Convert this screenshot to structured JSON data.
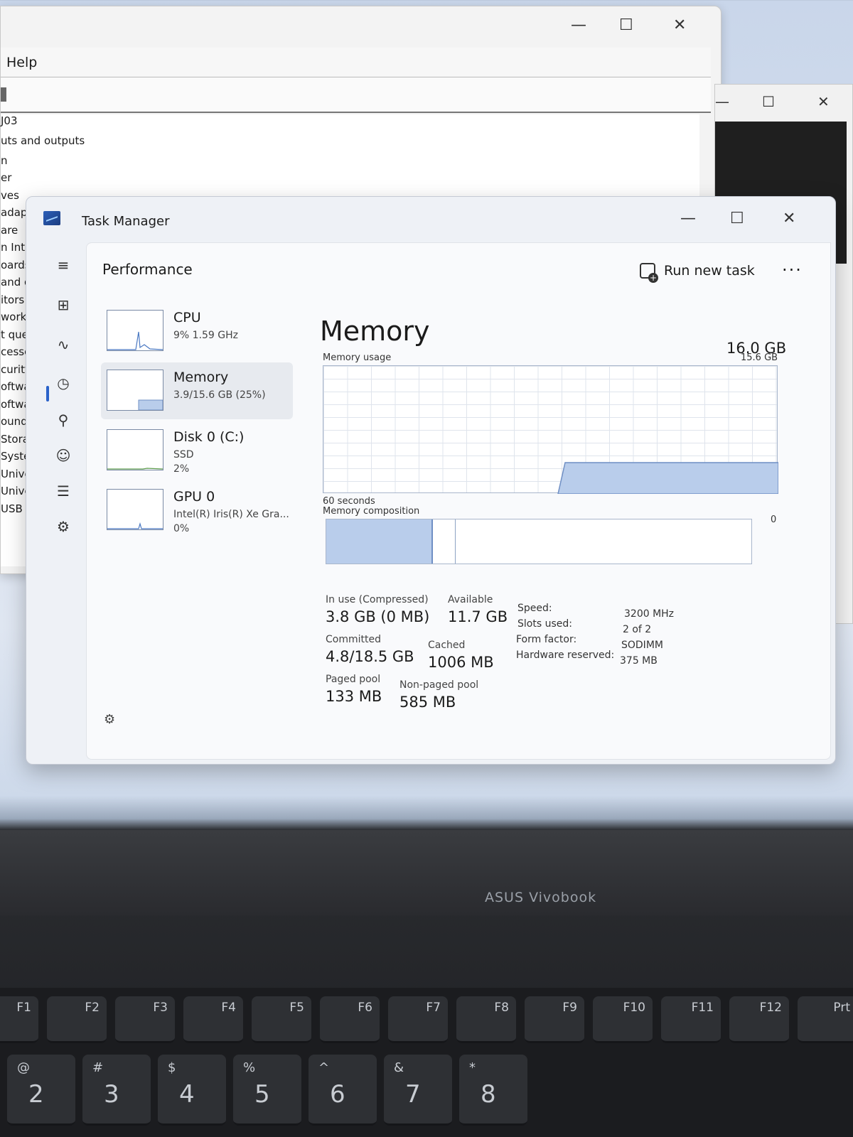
{
  "device_manager": {
    "menu_help": "Help",
    "tree_items": [
      "J03",
      "uts and outputs",
      "n",
      "er",
      "ves",
      "adap",
      "are",
      "n Interf",
      "oards",
      "and oth",
      "itors",
      "work adap",
      "t queues",
      "cessors",
      "curity devic",
      "oftware com",
      "oftware devi",
      "ound, video",
      "Storage contr",
      "System devic",
      "Universal Seri",
      "Universal Seri",
      "USB Connect"
    ]
  },
  "window_controls": {
    "minimize": "—",
    "maximize": "☐",
    "close": "✕"
  },
  "task_manager": {
    "title": "Task Manager",
    "page_title": "Performance",
    "run_new_task": "Run new task",
    "more": "···",
    "devices": [
      {
        "name": "CPU",
        "sub": "9%  1.59 GHz",
        "sub2": ""
      },
      {
        "name": "Memory",
        "sub": "3.9/15.6 GB (25%)",
        "sub2": ""
      },
      {
        "name": "Disk 0 (C:)",
        "sub": "SSD",
        "sub2": "2%"
      },
      {
        "name": "GPU 0",
        "sub": "Intel(R) Iris(R) Xe Gra...",
        "sub2": "0%"
      }
    ],
    "memory": {
      "heading": "Memory",
      "total": "16.0 GB",
      "usage_label": "Memory usage",
      "usage_max": "15.6 GB",
      "time_label": "60 seconds",
      "zero_label": "0",
      "composition_label": "Memory composition",
      "in_use_fraction": 0.25,
      "modified_fraction": 0.055,
      "stats": {
        "in_use_label": "In use (Compressed)",
        "in_use_value": "3.8 GB (0 MB)",
        "available_label": "Available",
        "available_value": "11.7 GB",
        "committed_label": "Committed",
        "committed_value": "4.8/18.5 GB",
        "cached_label": "Cached",
        "cached_value": "1006 MB",
        "paged_label": "Paged pool",
        "paged_value": "133 MB",
        "nonpaged_label": "Non-paged pool",
        "nonpaged_value": "585 MB"
      },
      "specs": [
        {
          "k": "Speed:",
          "v": "3200 MHz"
        },
        {
          "k": "Slots used:",
          "v": "2 of 2"
        },
        {
          "k": "Form factor:",
          "v": "SODIMM"
        },
        {
          "k": "Hardware reserved:",
          "v": "375 MB"
        }
      ]
    }
  },
  "laptop": {
    "brand": "ASUS Vivobook",
    "fkeys": [
      "F1",
      "F2",
      "F3",
      "F4",
      "F5",
      "F6",
      "F7",
      "F8",
      "F9",
      "F10",
      "F11",
      "F12",
      "Prt"
    ],
    "num_keys": [
      {
        "t": "@",
        "s": "2"
      },
      {
        "t": "#",
        "s": "3"
      },
      {
        "t": "$",
        "s": "4"
      },
      {
        "t": "%",
        "s": "5"
      },
      {
        "t": "^",
        "s": "6"
      },
      {
        "t": "&",
        "s": "7"
      },
      {
        "t": "*",
        "s": "8"
      }
    ]
  },
  "icons": {
    "hamburger": "≡",
    "processes": "⊞",
    "performance": "∿",
    "history": "◷",
    "startup": "⚲",
    "users": "☺",
    "details": "☰",
    "services": "⚙",
    "settings": "⚙"
  }
}
